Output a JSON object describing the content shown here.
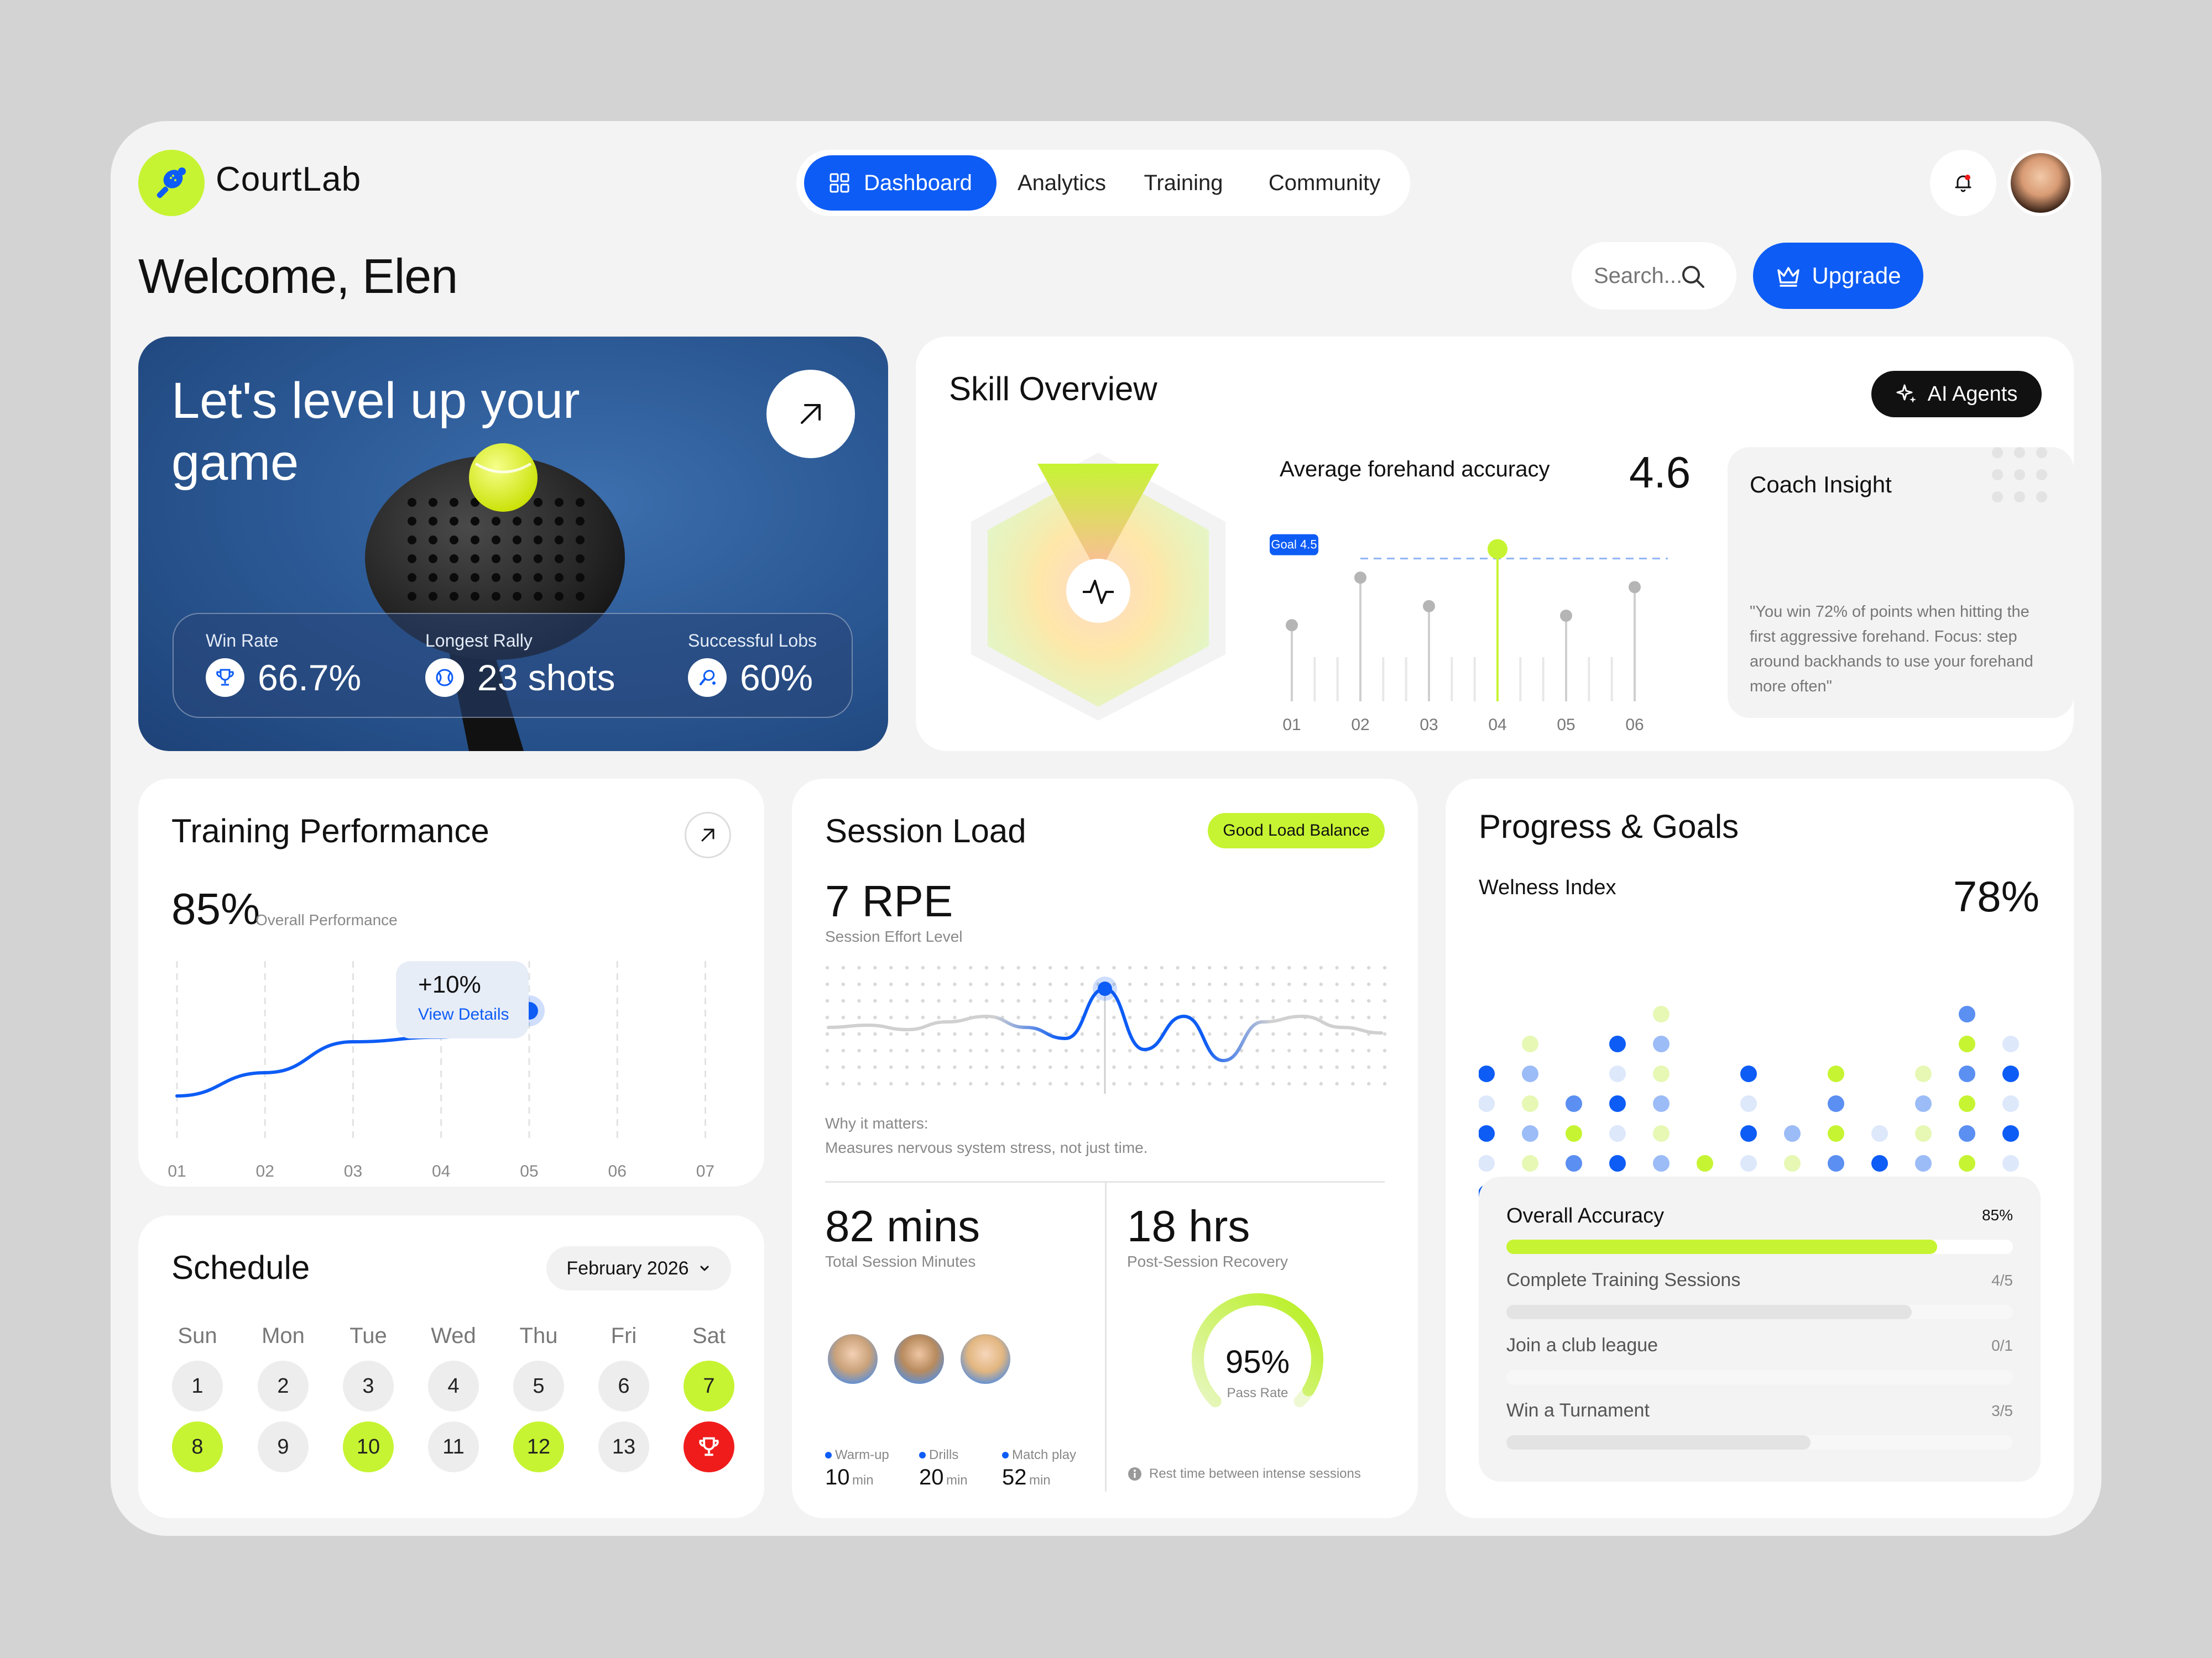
{
  "app": {
    "brand": "CourtLab"
  },
  "nav": {
    "tabs": [
      {
        "label": "Dashboard",
        "active": true
      },
      {
        "label": "Analytics",
        "active": false
      },
      {
        "label": "Training",
        "active": false
      },
      {
        "label": "Community",
        "active": false
      }
    ]
  },
  "header": {
    "welcome": "Welcome, Elen",
    "search_placeholder": "Search...",
    "upgrade_label": "Upgrade"
  },
  "hero": {
    "title": "Let's level up your game",
    "stats": [
      {
        "label": "Win Rate",
        "value": "66.7%",
        "icon": "trophy-icon"
      },
      {
        "label": "Longest Rally",
        "value": "23 shots",
        "icon": "ball-icon"
      },
      {
        "label": "Successful Lobs",
        "value": "60%",
        "icon": "racket-icon"
      }
    ]
  },
  "skill": {
    "title": "Skill Overview",
    "ai_label": "AI Agents",
    "metric_label": "Average forehand accuracy",
    "metric_value": "4.6",
    "goal_label": "Goal 4.5",
    "coach_title": "Coach Insight",
    "coach_quote": "\"You win 72% of points when hitting the first aggressive forehand. Focus: step around backhands to use your forehand more often\""
  },
  "training": {
    "title": "Training Performance",
    "value": "85%",
    "value_label": "Overall Performance",
    "tooltip_value": "+10%",
    "tooltip_link": "View Details"
  },
  "schedule": {
    "title": "Schedule",
    "month": "February 2026",
    "weekdays": [
      "Sun",
      "Mon",
      "Tue",
      "Wed",
      "Thu",
      "Fri",
      "Sat"
    ],
    "days": [
      "1",
      "2",
      "3",
      "4",
      "5",
      "6",
      "7",
      "8",
      "9",
      "10",
      "11",
      "12",
      "13"
    ],
    "highlighted_days": [
      "7",
      "8",
      "10",
      "12"
    ],
    "tournament_day": "14"
  },
  "session": {
    "title": "Session Load",
    "badge": "Good Load Balance",
    "rpe": "7 RPE",
    "rpe_label": "Session Effort Level",
    "why_title": "Why it matters:",
    "why_text": "Measures nervous system stress, not just time.",
    "minutes": "82 mins",
    "minutes_label": "Total Session Minutes",
    "recovery": "18 hrs",
    "recovery_label": "Post-Session Recovery",
    "pass_rate": "95%",
    "pass_rate_value": 95,
    "pass_label": "Pass Rate",
    "breakdown": [
      {
        "label": "Warm-up",
        "value": "10",
        "unit": "min"
      },
      {
        "label": "Drills",
        "value": "20",
        "unit": "min"
      },
      {
        "label": "Match play",
        "value": "52",
        "unit": "min"
      }
    ],
    "rest_note": "Rest time between intense sessions"
  },
  "progress": {
    "title": "Progress & Goals",
    "wellness_label": "Welness Index",
    "wellness_value": "78%",
    "goals": [
      {
        "label": "Overall Accuracy",
        "value": "85%",
        "fraction": 0.85
      },
      {
        "label": "Complete Training Sessions",
        "value": "4/5",
        "fraction": 0.8
      },
      {
        "label": "Join a club league",
        "value": "0/1",
        "fraction": 0
      },
      {
        "label": "Win a Turnament",
        "value": "3/5",
        "fraction": 0.6
      }
    ]
  },
  "colors": {
    "accent": "#0d5cf5",
    "lime": "#c6f432",
    "danger": "#f01c1c"
  },
  "chart_data": [
    {
      "type": "scatter",
      "title": "Average forehand accuracy",
      "categories": [
        "01",
        "02",
        "03",
        "04",
        "05",
        "06"
      ],
      "values": [
        3.8,
        4.3,
        4.0,
        4.6,
        3.9,
        4.2
      ],
      "goal": 4.5,
      "highlight": "04"
    },
    {
      "type": "line",
      "title": "Training Performance",
      "categories": [
        "01",
        "02",
        "03",
        "04",
        "05",
        "06",
        "07"
      ],
      "values": [
        20,
        35,
        55,
        58,
        75,
        null,
        null
      ],
      "ylim": [
        0,
        100
      ]
    },
    {
      "type": "line",
      "title": "Session Load",
      "values": [
        50,
        52,
        48,
        55,
        60,
        50,
        40,
        85,
        30,
        60,
        20,
        55,
        60,
        50,
        45
      ],
      "highlight_index": 7,
      "ylim": [
        0,
        100
      ]
    },
    {
      "type": "heatmap",
      "title": "Welness Index",
      "column_heights": [
        5,
        6,
        4,
        6,
        7,
        2,
        5,
        3,
        5,
        3,
        5,
        7,
        6,
        5
      ]
    }
  ]
}
